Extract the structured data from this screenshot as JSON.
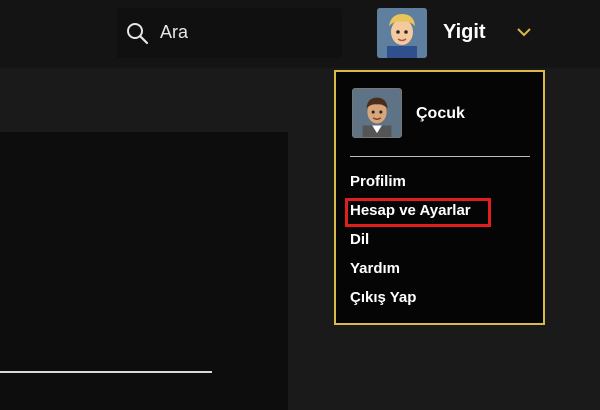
{
  "header": {
    "search": {
      "placeholder": "Ara",
      "icon": "search-icon"
    },
    "user": {
      "name": "Yigit",
      "avatar": "avatar",
      "chevron": "chevron-down-icon"
    }
  },
  "dropdown": {
    "profile": {
      "name": "Çocuk"
    },
    "items": [
      {
        "label": "Profilim"
      },
      {
        "label": "Hesap ve Ayarlar",
        "highlighted": true
      },
      {
        "label": "Dil"
      },
      {
        "label": "Yardım"
      },
      {
        "label": "Çıkış Yap"
      }
    ]
  },
  "colors": {
    "accent": "#d9b94a",
    "highlight": "#e01e1e",
    "background": "#1a1a1a"
  }
}
